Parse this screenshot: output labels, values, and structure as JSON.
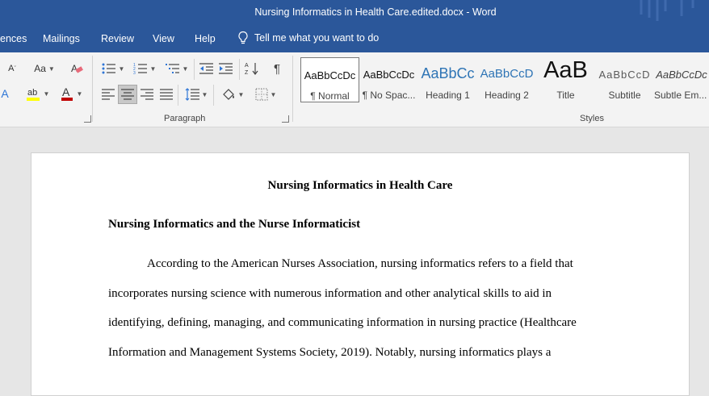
{
  "window": {
    "title": "Nursing Informatics in Health Care.edited.docx  -  Word"
  },
  "menu": {
    "items": [
      {
        "label": "ences"
      },
      {
        "label": "Mailings"
      },
      {
        "label": "Review"
      },
      {
        "label": "View"
      },
      {
        "label": "Help"
      }
    ],
    "tell_me": "Tell me what you want to do"
  },
  "ribbon": {
    "font_group": {
      "change_case": "Aa",
      "shrink": "A"
    },
    "paragraph_label": "Paragraph",
    "styles_label": "Styles",
    "styles": [
      {
        "preview": "AaBbCcDc",
        "name": "¶ Normal"
      },
      {
        "preview": "AaBbCcDc",
        "name": "¶ No Spac..."
      },
      {
        "preview": "AaBbCc",
        "name": "Heading 1"
      },
      {
        "preview": "AaBbCcD",
        "name": "Heading 2"
      },
      {
        "preview": "AaB",
        "name": "Title"
      },
      {
        "preview": "AaBbCcD",
        "name": "Subtitle"
      },
      {
        "preview": "AaBbCcDc",
        "name": "Subtle Em..."
      }
    ]
  },
  "document": {
    "title": "Nursing Informatics in Health Care",
    "heading": "Nursing Informatics and the Nurse Informaticist",
    "lines": [
      "According to the American Nurses Association, nursing informatics refers to a field that",
      "incorporates nursing science with numerous information and other analytical skills to aid in",
      "identifying, defining, managing, and communicating information in nursing practice (Healthcare",
      "Information and Management Systems Society, 2019). Notably, nursing informatics plays a"
    ]
  },
  "colors": {
    "accent": "#2b579a",
    "ribbon_bg": "#f3f3f3",
    "canvas_bg": "#e6e6e6"
  }
}
